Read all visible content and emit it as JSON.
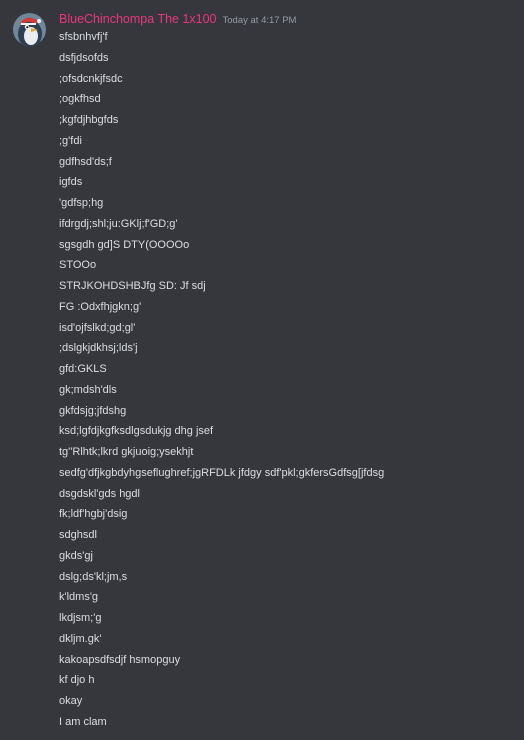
{
  "message": {
    "username": "BlueChinchompa The 1x100",
    "username_color": "#e9367f",
    "timestamp": "Today at 4:17 PM",
    "avatar_icon": "penguin-avatar-icon",
    "lines": [
      "sfsbnhvfj'f",
      "dsfjdsofds",
      ";ofsdcnkjfsdc",
      ";ogkfhsd",
      ";kgfdjhbgfds",
      ";g'fdi",
      "gdfhsd'ds;f",
      "igfds",
      "'gdfsp;hg",
      "ifdrgdj;shl;ju:GKlj;f'GD;g'",
      "sgsgdh gd]S DTY(OOOOo",
      "STOOo",
      "STRJKOHDSHBJfg SD: Jf sdj",
      "FG :Odxfhjgkn;g'",
      "isd'ojfslkd;gd;gl'",
      ";dslgkjdkhsj;lds'j",
      "gfd:GKLS",
      "gk;mdsh'dls",
      "gkfdsjg;jfdshg",
      "ksd;lgfdjkgfksdlgsdukjg dhg jsef",
      "tg''Rlhtk;lkrd gkjuoig;ysekhjt",
      "sedfg'dfjkgbdyhgseflughref;jgRFDLk jfdgy sdf'pkl;gkfersGdfsg[jfdsg",
      "dsgdskl'gds hgdl",
      "fk;ldf'hgbj'dsig",
      "sdghsdl",
      "gkds'gj",
      "dslg;ds'kl;jm,s",
      "k'ldms'g",
      "lkdjsm;'g",
      "dkljm.gk'",
      "kakoapsdfsdjf hsmopguy",
      "kf djo h",
      "okay",
      "I am clam"
    ]
  }
}
